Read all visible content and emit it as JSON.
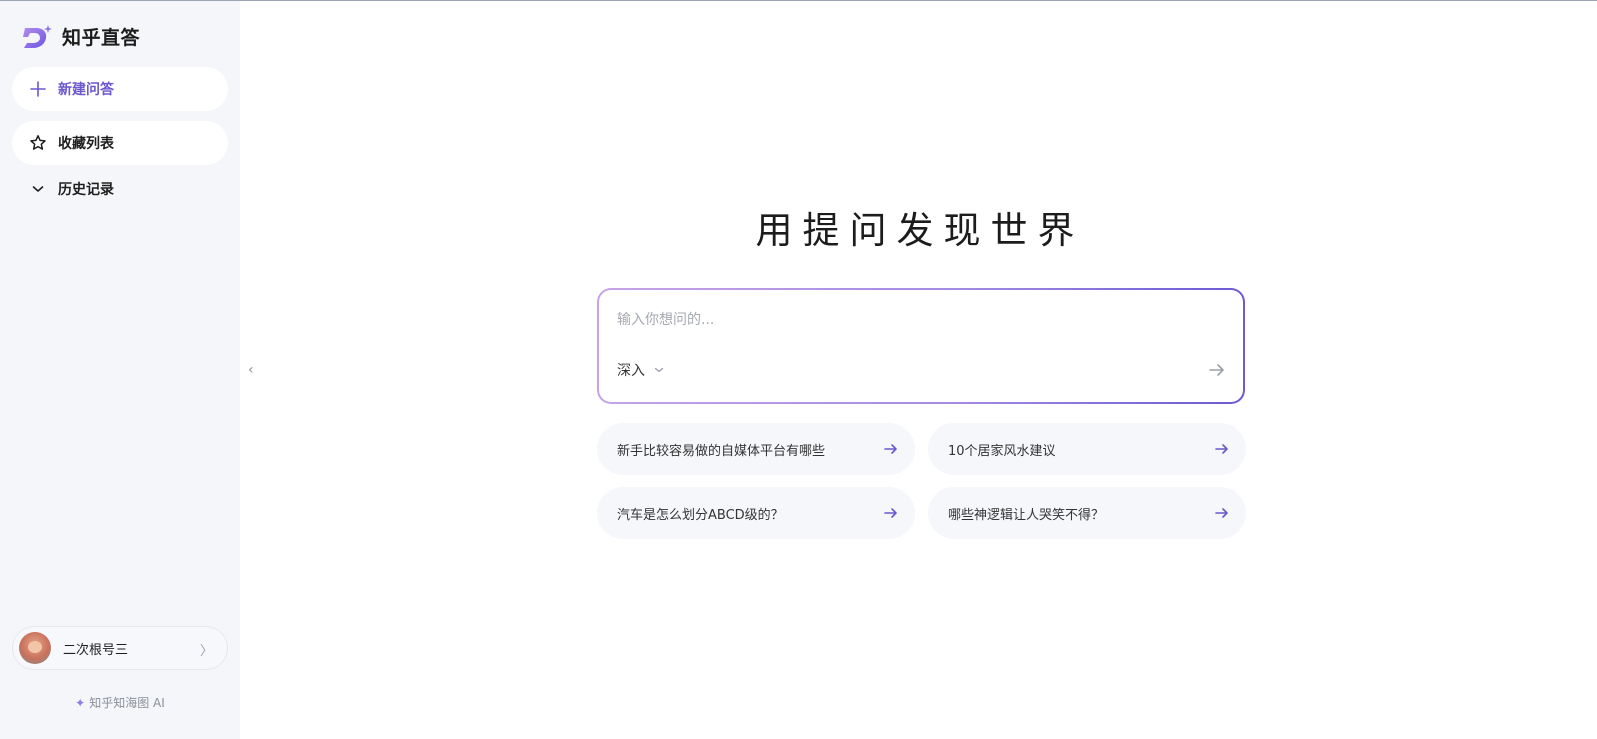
{
  "app": {
    "name": "知乎直答",
    "logo_icon": "zhida-logo-icon",
    "accent_color": "#6a58cf"
  },
  "sidebar": {
    "new_question": {
      "label": "新建问答",
      "icon": "plus-icon"
    },
    "favorites": {
      "label": "收藏列表",
      "icon": "star-icon"
    },
    "history": {
      "label": "历史记录",
      "icon": "chevron-down-icon"
    }
  },
  "user": {
    "name": "二次根号三",
    "avatar": "avatar",
    "chevron": "〉"
  },
  "footer": {
    "brand": "知乎知海图 AI",
    "spark": "✦"
  },
  "collapse": {
    "glyph": "‹"
  },
  "main": {
    "title": "用提问发现世界",
    "input_placeholder": "输入你想问的...",
    "input_value": "",
    "mode_label": "深入",
    "send_icon": "send-arrow-icon"
  },
  "suggestions": [
    {
      "text": "新手比较容易做的自媒体平台有哪些"
    },
    {
      "text": "10个居家风水建议"
    },
    {
      "text": "汽车是怎么划分ABCD级的？"
    },
    {
      "text": "哪些神逻辑让人哭笑不得？"
    }
  ]
}
